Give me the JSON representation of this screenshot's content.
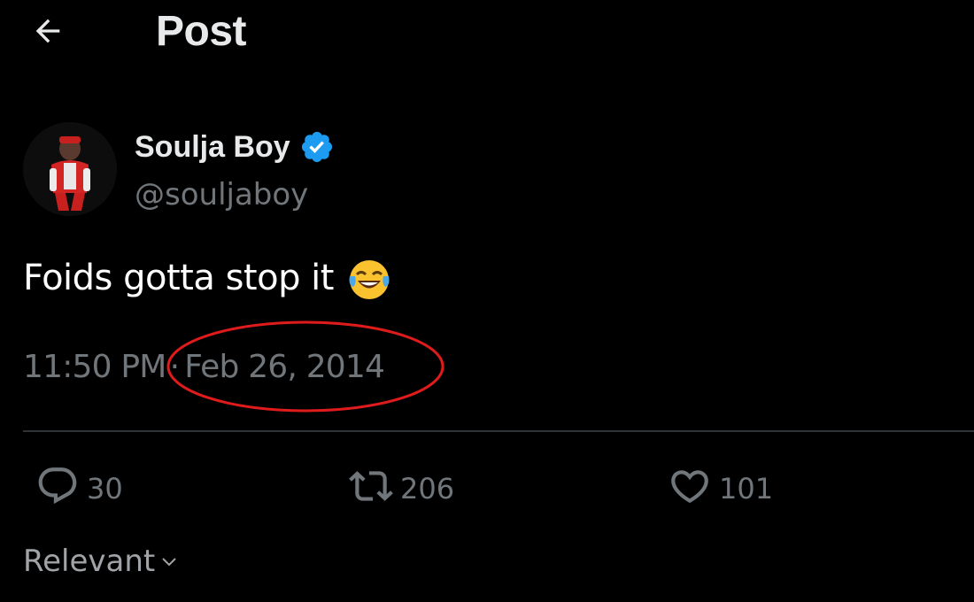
{
  "header": {
    "title": "Post",
    "back_icon": "arrow-left-icon"
  },
  "author": {
    "display_name": "Soulja Boy",
    "handle": "@souljaboy",
    "verified": true,
    "verified_color": "#1d9bf0",
    "avatar_icon": "avatar-photo"
  },
  "post": {
    "text": "Foids gotta stop it",
    "emoji": "face-with-tears-of-joy",
    "time": "11:50 PM",
    "separator": "·",
    "date": "Feb 26, 2014",
    "annotation_color": "#e01b1b"
  },
  "actions": {
    "replies": {
      "icon": "reply-icon",
      "count": "30"
    },
    "reposts": {
      "icon": "repost-icon",
      "count": "206"
    },
    "likes": {
      "icon": "heart-icon",
      "count": "101"
    }
  },
  "sort": {
    "label": "Relevant",
    "icon": "chevron-down-icon"
  },
  "colors": {
    "background": "#000000",
    "text_primary": "#e7e9ea",
    "text_secondary": "#71767b",
    "divider": "#2f3336"
  }
}
